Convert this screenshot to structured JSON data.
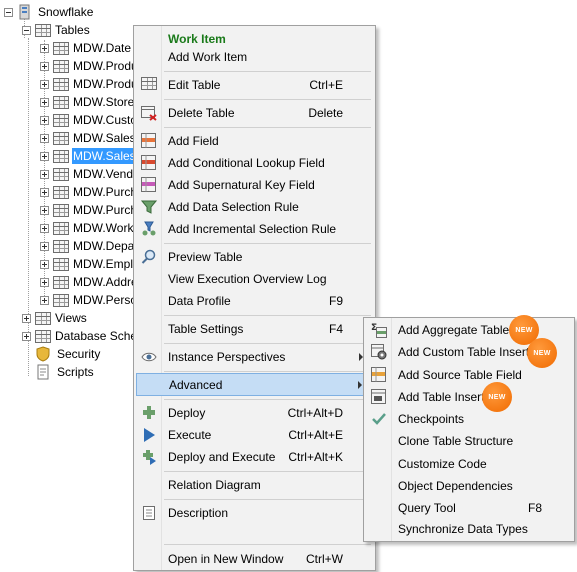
{
  "tree": {
    "root": "Snowflake",
    "tables_folder": "Tables",
    "tables": [
      "MDW.Date",
      "MDW.Produ",
      "MDW.Produ",
      "MDW.Store",
      "MDW.Custo",
      "MDW.Sales",
      "MDW.Sales",
      "MDW.Vend",
      "MDW.Purch",
      "MDW.Purch",
      "MDW.Work",
      "MDW.Depa",
      "MDW.Empl",
      "MDW.Addre",
      "MDW.Perso"
    ],
    "views": "Views",
    "schemas": "Database Sche",
    "security": "Security",
    "scripts": "Scripts"
  },
  "context_menu": {
    "header": "Work Item",
    "add_work_item": "Add Work Item",
    "edit_table": "Edit Table",
    "edit_table_sc": "Ctrl+E",
    "delete_table": "Delete Table",
    "delete_table_sc": "Delete",
    "add_field": "Add Field",
    "add_conditional_lookup_field": "Add Conditional Lookup Field",
    "add_supernatural_key_field": "Add Supernatural Key Field",
    "add_data_selection_rule": "Add Data Selection Rule",
    "add_incremental_selection_rule": "Add Incremental Selection Rule",
    "preview_table": "Preview Table",
    "view_execution_overview_log": "View Execution Overview Log",
    "data_profile": "Data Profile",
    "data_profile_sc": "F9",
    "table_settings": "Table Settings",
    "table_settings_sc": "F4",
    "instance_perspectives": "Instance Perspectives",
    "advanced": "Advanced",
    "deploy": "Deploy",
    "deploy_sc": "Ctrl+Alt+D",
    "execute": "Execute",
    "execute_sc": "Ctrl+Alt+E",
    "deploy_and_execute": "Deploy and Execute",
    "deploy_and_execute_sc": "Ctrl+Alt+K",
    "relation_diagram": "Relation Diagram",
    "description": "Description",
    "open_in_new_window": "Open in New Window",
    "open_in_new_window_sc": "Ctrl+W"
  },
  "submenu": {
    "add_aggregate_table": "Add Aggregate Table",
    "add_custom_table_insert": "Add Custom Table Insert",
    "add_source_table_field": "Add Source Table Field",
    "add_table_insert": "Add Table Insert",
    "checkpoints": "Checkpoints",
    "clone_table_structure": "Clone Table Structure",
    "customize_code": "Customize Code",
    "object_dependencies": "Object Dependencies",
    "query_tool": "Query Tool",
    "query_tool_sc": "F8",
    "synchronize_data_types": "Synchronize Data Types",
    "new_badge": "NEW"
  },
  "colors": {
    "selection": "#3399ff",
    "menu_highlight": "#c5ddf5",
    "header_green": "#1a7a1a",
    "badge_orange": "#f06a00"
  }
}
